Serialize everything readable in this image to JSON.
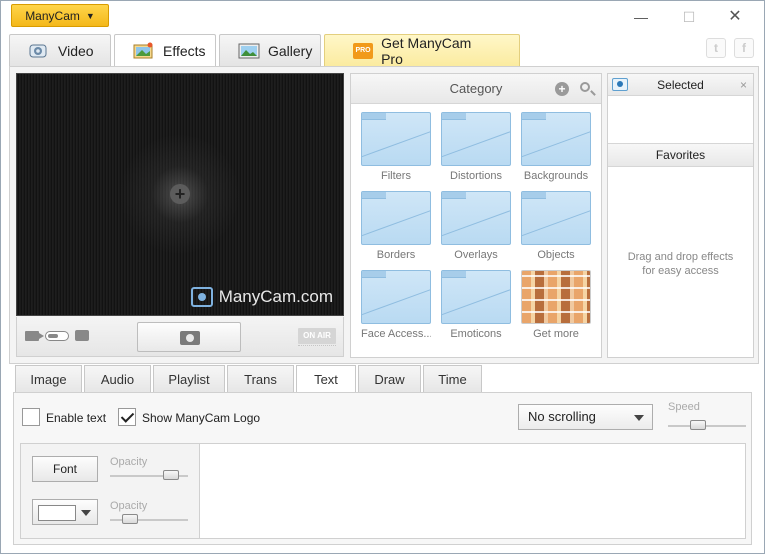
{
  "app": {
    "brand_label": "ManyCam"
  },
  "window_controls": {
    "minimize": "—",
    "maximize": "☐",
    "close": "✕"
  },
  "main_tabs": [
    {
      "label": "Video",
      "icon": "webcam-icon"
    },
    {
      "label": "Effects",
      "icon": "effects-icon",
      "active": true
    },
    {
      "label": "Gallery",
      "icon": "gallery-icon"
    },
    {
      "label": "Get ManyCam Pro",
      "icon": "pro-badge",
      "badge": "PRO"
    }
  ],
  "social": {
    "twitter": "t",
    "facebook": "f"
  },
  "preview": {
    "watermark": "ManyCam.com",
    "on_air": "ON AIR",
    "plus": "+"
  },
  "category": {
    "title": "Category",
    "add": "+",
    "items": [
      {
        "label": "Filters"
      },
      {
        "label": "Distortions"
      },
      {
        "label": "Backgrounds"
      },
      {
        "label": "Borders"
      },
      {
        "label": "Overlays"
      },
      {
        "label": "Objects"
      },
      {
        "label": "Face Access..."
      },
      {
        "label": "Emoticons"
      },
      {
        "label": "Get more"
      }
    ]
  },
  "selected": {
    "title": "Selected",
    "close": "×",
    "favorites_title": "Favorites",
    "hint_line1": "Drag and drop effects",
    "hint_line2": "for easy access"
  },
  "sub_tabs": [
    {
      "label": "Image"
    },
    {
      "label": "Audio"
    },
    {
      "label": "Playlist"
    },
    {
      "label": "Trans"
    },
    {
      "label": "Text",
      "active": true
    },
    {
      "label": "Draw"
    },
    {
      "label": "Time"
    }
  ],
  "text_panel": {
    "enable_text_label": "Enable text",
    "enable_text_checked": false,
    "show_logo_label": "Show ManyCam Logo",
    "show_logo_checked": true,
    "scrolling_value": "No scrolling",
    "speed_label": "Speed",
    "speed_level": 0.35,
    "font_button": "Font",
    "opacity_label_1": "Opacity",
    "opacity_1_level": 0.85,
    "opacity_label_2": "Opacity",
    "opacity_2_level": 0.2,
    "text_color": "#ffffff"
  },
  "colors": {
    "brand": "#f4b81a",
    "pro_tab": "#fbeba0",
    "folder": "#cfe6f7"
  }
}
